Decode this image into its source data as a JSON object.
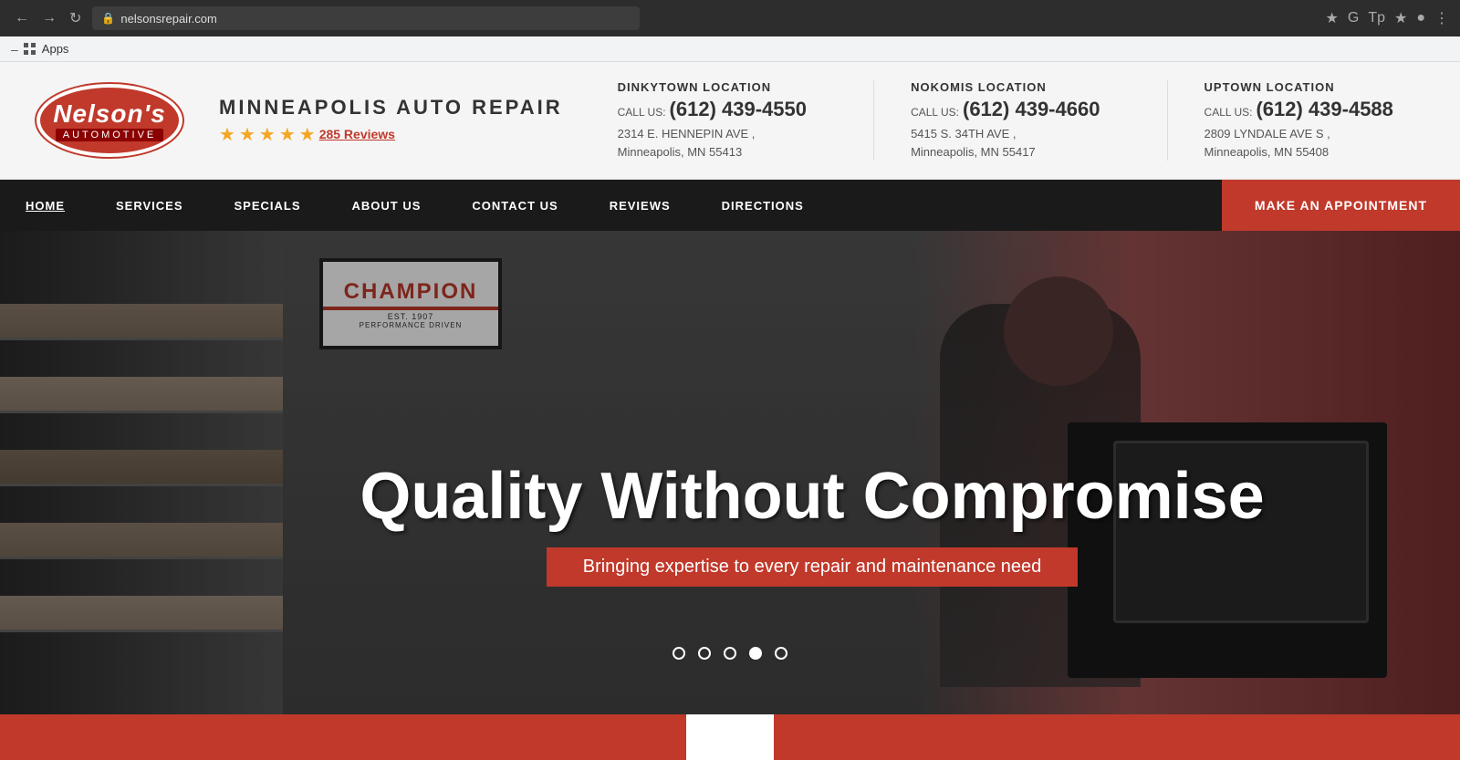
{
  "browser": {
    "url": "nelsonsrepair.com",
    "back_disabled": false,
    "forward_disabled": false
  },
  "apps_bar": {
    "label": "Apps"
  },
  "header": {
    "logo": {
      "name": "Nelson's",
      "sub": "AUTOMOTIVE"
    },
    "brand_title": "MINNEAPOLIS AUTO REPAIR",
    "stars_count": 5,
    "reviews_text": "285 Reviews",
    "locations": [
      {
        "title": "DINKYTOWN LOCATION",
        "call_label": "CALL US:",
        "phone": "(612) 439-4550",
        "address_line1": "2314 E. HENNEPIN AVE ,",
        "address_line2": "Minneapolis, MN 55413"
      },
      {
        "title": "NOKOMIS LOCATION",
        "call_label": "CALL US:",
        "phone": "(612) 439-4660",
        "address_line1": "5415 S. 34TH AVE ,",
        "address_line2": "Minneapolis, MN 55417"
      },
      {
        "title": "UPTOWN LOCATION",
        "call_label": "CALL US:",
        "phone": "(612) 439-4588",
        "address_line1": "2809 LYNDALE AVE S ,",
        "address_line2": "Minneapolis, MN 55408"
      }
    ]
  },
  "nav": {
    "items": [
      {
        "label": "HOME",
        "active": true
      },
      {
        "label": "SERVICES",
        "active": false
      },
      {
        "label": "SPECIALS",
        "active": false
      },
      {
        "label": "ABOUT US",
        "active": false
      },
      {
        "label": "CONTACT US",
        "active": false
      },
      {
        "label": "REVIEWS",
        "active": false
      },
      {
        "label": "DIRECTIONS",
        "active": false
      }
    ],
    "cta_label": "MAKE AN APPOINTMENT"
  },
  "hero": {
    "title": "Quality Without Compromise",
    "subtitle": "Bringing expertise to every repair and maintenance need",
    "dots": [
      {
        "active": false
      },
      {
        "active": false
      },
      {
        "active": false
      },
      {
        "active": true
      },
      {
        "active": false
      }
    ]
  }
}
